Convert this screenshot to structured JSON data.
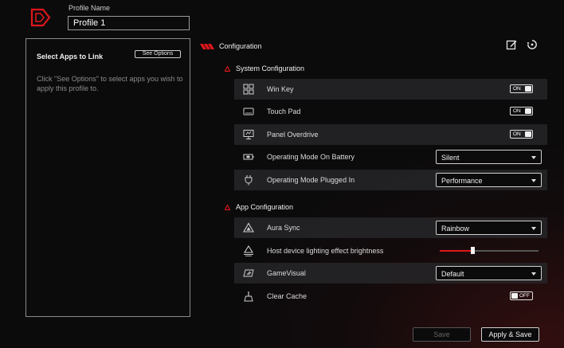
{
  "profile": {
    "label": "Profile Name",
    "value": "Profile 1"
  },
  "apps": {
    "title": "Select Apps to Link",
    "see_options": "See Options",
    "hint": "Click \"See Options\" to select apps you wish to apply this profile to."
  },
  "config": {
    "title": "Configuration",
    "edit_icon": "edit-icon",
    "reset_icon": "reset-icon"
  },
  "system_config": {
    "title": "System Configuration",
    "items": [
      {
        "label": "Win Key",
        "icon": "windows-key-icon",
        "toggle": "ON"
      },
      {
        "label": "Touch Pad",
        "icon": "touchpad-icon",
        "toggle": "ON"
      },
      {
        "label": "Panel Overdrive",
        "icon": "panel-overdrive-icon",
        "toggle": "ON"
      },
      {
        "label": "Operating Mode On Battery",
        "icon": "battery-icon",
        "select": "Silent"
      },
      {
        "label": "Operating Mode Plugged In",
        "icon": "plug-icon",
        "select": "Performance"
      }
    ]
  },
  "app_config": {
    "title": "App Configuration",
    "items": [
      {
        "label": "Aura Sync",
        "icon": "aura-sync-icon",
        "select": "Rainbow"
      },
      {
        "label": "Host device lighting effect brightness",
        "icon": "brightness-icon",
        "slider_fraction": 0.33
      },
      {
        "label": "GameVisual",
        "icon": "gamevisual-icon",
        "select": "Default"
      },
      {
        "label": "Clear Cache",
        "icon": "broom-icon",
        "toggle": "OFF"
      }
    ]
  },
  "buttons": {
    "save": "Save",
    "apply_save": "Apply & Save"
  },
  "colors": {
    "accent": "#e0161b",
    "background": "#0b0b0c",
    "panel_row": "#262628"
  }
}
